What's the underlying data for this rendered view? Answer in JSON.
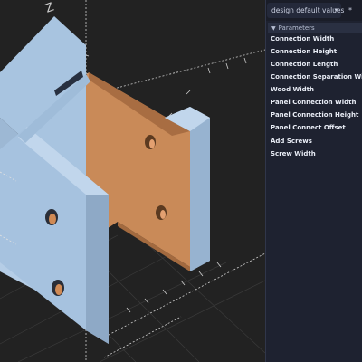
{
  "preset": {
    "label": "design default values",
    "chevron_icon": "chevron-down-icon",
    "extra_icon": "asterisk-icon"
  },
  "parameters": {
    "section_label": "Parameters",
    "items": [
      "Connection Width",
      "Connection Height",
      "Connection Length",
      "Connection Separation Width",
      "Wood Width",
      "Panel Connection Width",
      "Panel Connection Height",
      "Panel Connect Offset",
      "Add Screws",
      "Screw Width"
    ]
  },
  "viewport": {
    "axis_label": "Z",
    "model_colors": {
      "bracket": "#a8c4e0",
      "wood": "#c98a58",
      "background": "#222222"
    }
  }
}
